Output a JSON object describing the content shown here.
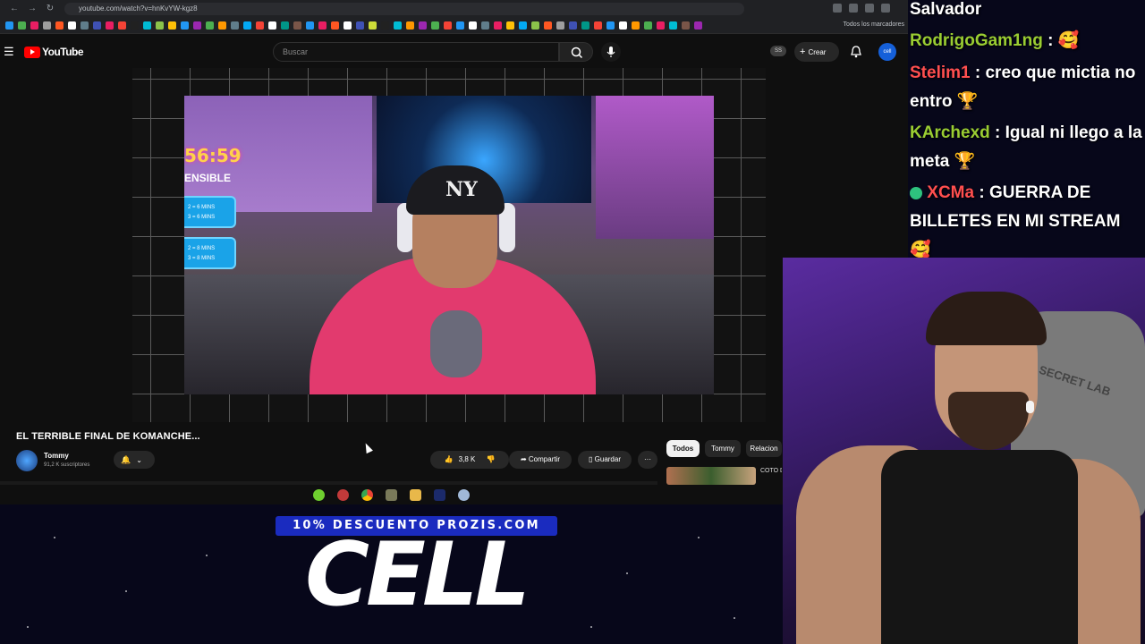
{
  "browser": {
    "url": "youtube.com/watch?v=hnKvYW-kgz8",
    "bookmarks_folder": "Todos los marcadores"
  },
  "youtube": {
    "logo_text": "YouTube",
    "search_placeholder": "Buscar",
    "ss_badge": "SS",
    "create_label": "Crear",
    "avatar_text": "cell"
  },
  "video": {
    "overlay_timer": "56:59",
    "overlay_label": "ENSIBLE",
    "overlay_boxes": [
      "2 = 6 MINS\n3 = 6 MINS",
      "2 = 8 MINS\n3 = 8 MINS"
    ],
    "cap_logo": "NY",
    "title": "EL TERRIBLE FINAL DE KOMANCHE...",
    "channel_name": "Tommy",
    "channel_subs": "91,2 K suscriptores",
    "likes": "3,8 K",
    "share_label": "Compartir",
    "save_label": "Guardar",
    "more_label": "···"
  },
  "chips": [
    "Todos",
    "Tommy",
    "Relacion"
  ],
  "recommendation_title": "COTO DE SU",
  "chat": [
    {
      "user": "",
      "text": "Salvador",
      "color": "#ffffff"
    },
    {
      "user": "RodrigoGam1ng",
      "text": ": 🥰",
      "color": "#9acd32"
    },
    {
      "user": "Stelim1",
      "text": ": creo que mictia no entro 🏆",
      "color": "#ff4f4f"
    },
    {
      "user": "KArchexd",
      "text": ": Igual ni llego a la meta 🏆",
      "color": "#9acd32"
    },
    {
      "user": "XCMa",
      "text": ": GUERRA DE BILLETES EN MI STREAM 🥰",
      "color": "#ff4f4f"
    }
  ],
  "webcam": {
    "chair_logo": "SECRET LAB"
  },
  "ad": {
    "tagline": "10% DESCUENTO PROZIS.COM",
    "brand": "CELL"
  },
  "colors": {
    "youtube_red": "#ff0000",
    "chip_active": "#f1f1f1",
    "ad_blue": "#1a2bbf",
    "chat_green": "#9acd32",
    "chat_red": "#ff4f4f"
  }
}
